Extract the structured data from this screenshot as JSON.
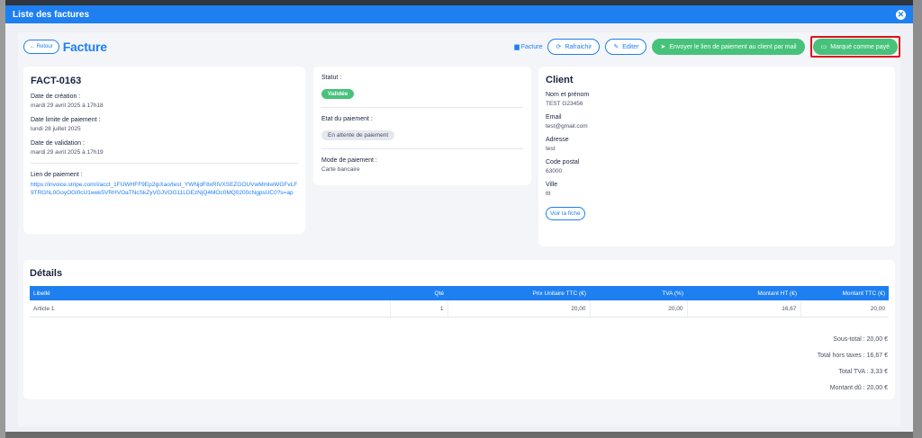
{
  "modal": {
    "title": "Liste des factures",
    "close_icon": "close-icon"
  },
  "toolbar": {
    "back_label": "← Retour",
    "page_title": "Facture",
    "facture_link": "Facture",
    "refresh_label": "Rafraichir",
    "edit_label": "Editer",
    "send_link_label": "Envoyer le lien de paiement au client par mail",
    "mark_paid_label": "Marqué comme payé"
  },
  "invoice": {
    "number": "FACT-0163",
    "creation_label": "Date de création :",
    "creation_value": "mardi 29 avril 2025 à 17h18",
    "due_label": "Date limite de paiement :",
    "due_value": "lundi 28 juillet 2025",
    "validation_label": "Date de validation :",
    "validation_value": "mardi 29 avril 2025 à 17h19",
    "payment_link_label": "Lien de paiement :",
    "payment_link_value": "https://invoice.stripe.com/i/acct_1FUWHFF9Ep2ipXao/test_YWNjdF8xRlVXSEZGOUVwMmlwWGFvLF9TRGhL0GoyOGl0cU1wek5VRHVOaTNcSkZyVGJVOG11LDEzNjQ4MOc0MQ0200cNgpsUC0?s=ap"
  },
  "status": {
    "status_label": "Statut :",
    "status_value": "Validée",
    "payment_state_label": "Etat du paiement :",
    "payment_state_value": "En attente de paiement",
    "payment_mode_label": "Mode de paiement :",
    "payment_mode_value": "Carte bancaire"
  },
  "client": {
    "title": "Client",
    "name_label": "Nom et prénom",
    "name_value": "TEST G23456",
    "email_label": "Email",
    "email_value": "test@gmail.com",
    "address_label": "Adresse",
    "address_value": "test",
    "postal_label": "Code postal",
    "postal_value": "63000",
    "city_label": "Ville",
    "city_value": "ttt",
    "view_button": "Voir la fiche"
  },
  "details": {
    "title": "Détails",
    "columns": [
      "Libellé",
      "Qté",
      "Prix Unitaire TTC (€)",
      "TVA (%)",
      "Montant HT (€)",
      "Montant TTC (€)"
    ],
    "rows": [
      [
        "Article 1",
        "1",
        "20,00",
        "20,00",
        "16,67",
        "20,00"
      ]
    ],
    "totals": {
      "subtotal": "Sous-total : 20,00 €",
      "total_ht": "Total hors taxes : 16,67 €",
      "total_tva": "Total TVA : 3,33 €",
      "amount_due": "Montant dû : 20,00 €"
    }
  },
  "colors": {
    "primary": "#1e7ff0",
    "success": "#47c27a",
    "highlight": "#e0121c"
  }
}
